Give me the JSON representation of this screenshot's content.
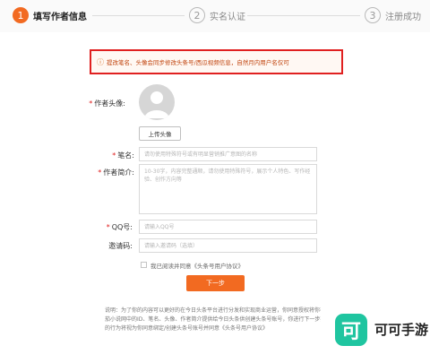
{
  "steps": [
    {
      "num": "1",
      "label": "填写作者信息"
    },
    {
      "num": "2",
      "label": "实名认证"
    },
    {
      "num": "3",
      "label": "注册成功"
    }
  ],
  "notice": {
    "icon": "info-icon",
    "icon_glyph": "ⓘ",
    "text": "提改笔名、头像会同步修改头条号/西瓜视频信息，自然月内用户名仅可"
  },
  "form": {
    "avatar": {
      "label": "作者头像:",
      "upload_label": "上传头像"
    },
    "penname": {
      "label": "笔名:",
      "placeholder": "请勿使用特殊符号或有明显营销推广意图的名称"
    },
    "intro": {
      "label": "作者简介:",
      "placeholder": "10-30字，内容完整通顺，请勿使用特殊符号，展示个人特色、写作经验、创作方向等"
    },
    "qq": {
      "label": "QQ号:",
      "placeholder": "请输入QQ号"
    },
    "invite": {
      "label": "邀请码:",
      "placeholder": "请输入邀请码（选填）"
    },
    "agreement": "我已阅读并同意《头条号用户协议》",
    "next_label": "下一步"
  },
  "description": "说明：为了你的内容可以更好的在今日头条平台进行分发和实现商业运营，你同意授权将你在番茄小说网中的ID、笔名、头像、作者简介提供给今日头条供创建头条号账号，你进行下一步操作的行为将视为你同意绑定/创建头条号账号并同意《头条号用户协议》",
  "watermark": {
    "logo_char": "可",
    "name": "可可手游"
  },
  "colors": {
    "accent": "#f26a21",
    "required": "#e02020",
    "notice_border": "#e02020",
    "watermark": "#1fc5a0"
  }
}
